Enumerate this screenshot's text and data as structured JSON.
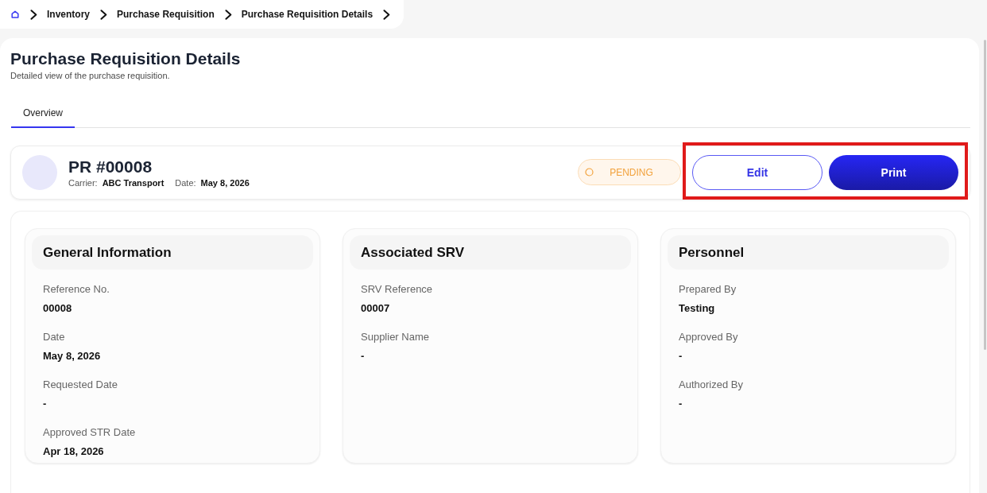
{
  "breadcrumb": {
    "items": [
      {
        "label": "Inventory"
      },
      {
        "label": "Purchase Requisition"
      },
      {
        "label": "Purchase Requisition Details"
      }
    ]
  },
  "page": {
    "title": "Purchase Requisition Details",
    "subtitle": "Detailed view of the purchase requisition."
  },
  "tabs": [
    {
      "label": "Overview",
      "selected": true
    }
  ],
  "header": {
    "title": "PR #00008",
    "meta": [
      {
        "label": "Carrier:",
        "value": "ABC Transport"
      },
      {
        "label": "Date:",
        "value": "May 8, 2026"
      }
    ],
    "status": {
      "label": "PENDING",
      "kind": "pending"
    },
    "actions_highlighted": true,
    "actions": [
      {
        "label": "Edit",
        "kind": "outline"
      },
      {
        "label": "Print",
        "kind": "primary"
      }
    ]
  },
  "sections": [
    {
      "title": "General Information",
      "fields": [
        {
          "label": "Reference No.",
          "value": "00008"
        },
        {
          "label": "Date",
          "value": "May 8, 2026"
        },
        {
          "label": "Requested Date",
          "value": "-"
        },
        {
          "label": "Approved STR Date",
          "value": "Apr 18, 2026"
        }
      ]
    },
    {
      "title": "Associated SRV",
      "fields": [
        {
          "label": "SRV Reference",
          "value": "00007"
        },
        {
          "label": "Supplier Name",
          "value": "-"
        }
      ]
    },
    {
      "title": "Personnel",
      "fields": [
        {
          "label": "Prepared By",
          "value": "Testing"
        },
        {
          "label": "Approved By",
          "value": "-"
        },
        {
          "label": "Authorized By",
          "value": "-"
        }
      ]
    }
  ]
}
